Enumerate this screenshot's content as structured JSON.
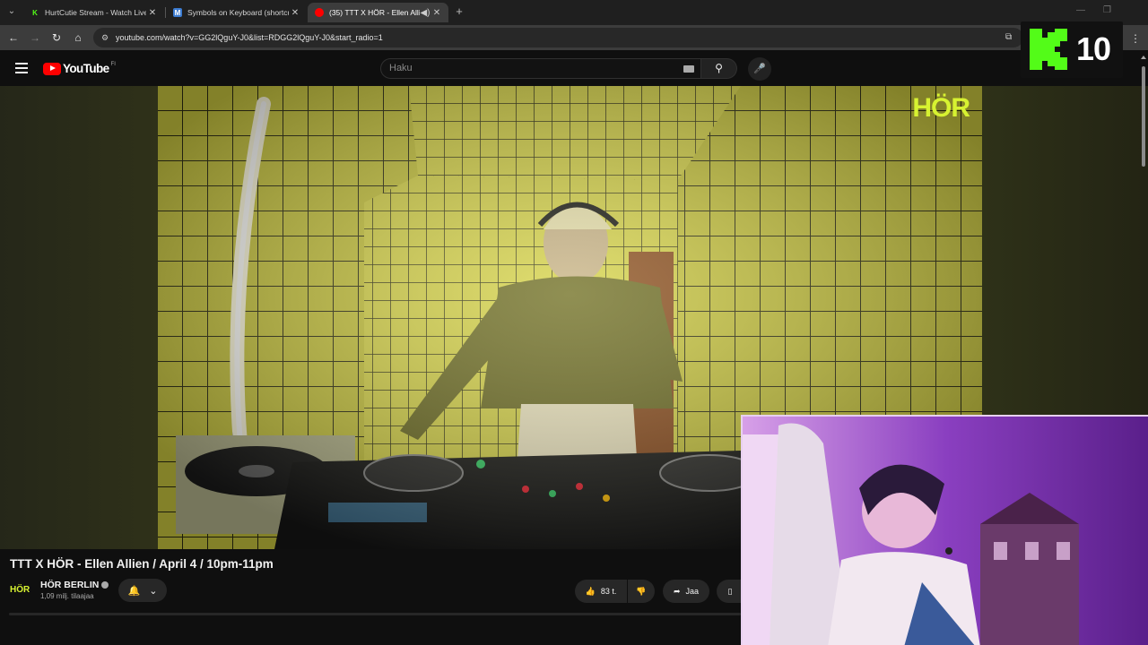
{
  "browser": {
    "tabs": [
      {
        "title": "HurtCutie Stream - Watch Live o",
        "favicon": "kick-icon",
        "active": false
      },
      {
        "title": "Symbols on Keyboard (shortcut",
        "favicon": "m-icon",
        "active": false
      },
      {
        "title": "(35) TTT X HÖR - Ellen Allie",
        "favicon": "youtube-icon",
        "active": true
      }
    ],
    "url": "youtube.com/watch?v=GG2lQguY-J0&list=RDGG2lQguY-J0&start_radio=1"
  },
  "youtube": {
    "region_code": "FI",
    "search_placeholder": "Haku"
  },
  "video": {
    "title": "TTT X HÖR - Ellen Allien / April 4 / 10pm-11pm",
    "overlay_logo": "HÖR",
    "channel": {
      "avatar_text": "HÖR",
      "name": "HÖR BERLIN",
      "subscribers": "1,09 milj. tilaajaa"
    },
    "actions": {
      "likes": "83 t.",
      "share_label": "Jaa"
    }
  },
  "stream_overlay": {
    "counter": "10"
  },
  "colors": {
    "accent_lime": "#d7f231",
    "youtube_red": "#ff0000",
    "kick_green": "#53fc18"
  }
}
